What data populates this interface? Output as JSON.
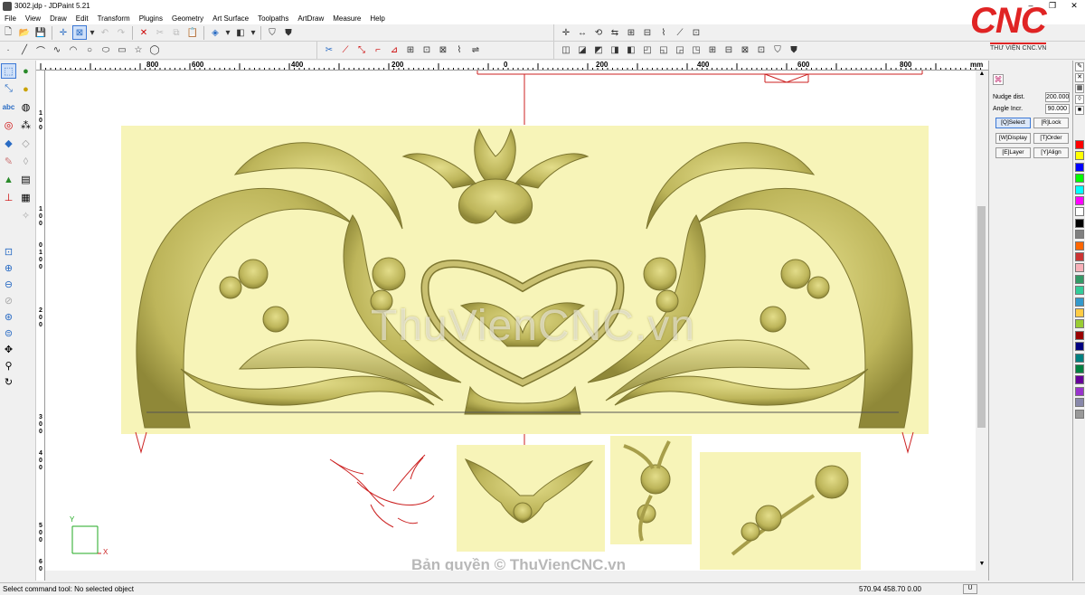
{
  "window": {
    "title": "3002.jdp - JDPaint 5.21",
    "controls": [
      "–",
      "❐",
      "✕"
    ]
  },
  "menu": [
    "File",
    "View",
    "Draw",
    "Edit",
    "Transform",
    "Plugins",
    "Geometry",
    "Art Surface",
    "Toolpaths",
    "ArtDraw",
    "Measure",
    "Help"
  ],
  "logo": {
    "brand": "CNC",
    "tagline": "THƯ VIỆN CNC.VN"
  },
  "ruler": {
    "h_labels": [
      "800",
      "600",
      "400",
      "200",
      "0",
      "200",
      "400",
      "600",
      "800"
    ],
    "unit": "mm",
    "v_labels": [
      "1",
      "0",
      "0",
      "1",
      "0",
      "0",
      "0",
      "1",
      "0",
      "0",
      "2",
      "0",
      "0",
      "3",
      "0",
      "0",
      "4",
      "0",
      "0",
      "5",
      "0",
      "0",
      "6",
      "0"
    ]
  },
  "panel": {
    "nudge_label": "Nudge dist.",
    "nudge_value": "200.000",
    "angle_label": "Angle Incr.",
    "angle_value": "90.000",
    "buttons": [
      {
        "label": "[Q]Select",
        "active": true
      },
      {
        "label": "[R]Lock",
        "active": false
      },
      {
        "label": "[W]Display",
        "active": false
      },
      {
        "label": "[T]Order",
        "active": false
      },
      {
        "label": "[E]Layer",
        "active": false
      },
      {
        "label": "[Y]Align",
        "active": false
      }
    ]
  },
  "palette": [
    "#ff0000",
    "#ffff00",
    "#0000ff",
    "#00ff00",
    "#00ffff",
    "#ff00ff",
    "#ffffff",
    "#000000",
    "#808080",
    "#ff6600",
    "#cc3333",
    "#f7b0b8",
    "#339966",
    "#33cc99",
    "#3399cc",
    "#ffcc44",
    "#99cc33",
    "#990000",
    "#000080",
    "#008080",
    "#008040",
    "#660099",
    "#9933cc",
    "#8888aa",
    "#999999"
  ],
  "canvas": {
    "watermark": "ThuVienCNC.vn",
    "copyright": "Bản quyền © ThuVienCNC.vn",
    "panel_color": "#f7f4b8",
    "axis_x": "X",
    "axis_y": "Y"
  },
  "status": {
    "message": "Select command tool: No selected object",
    "coords": "570.94 458.70 0.00",
    "indicator": "U"
  }
}
